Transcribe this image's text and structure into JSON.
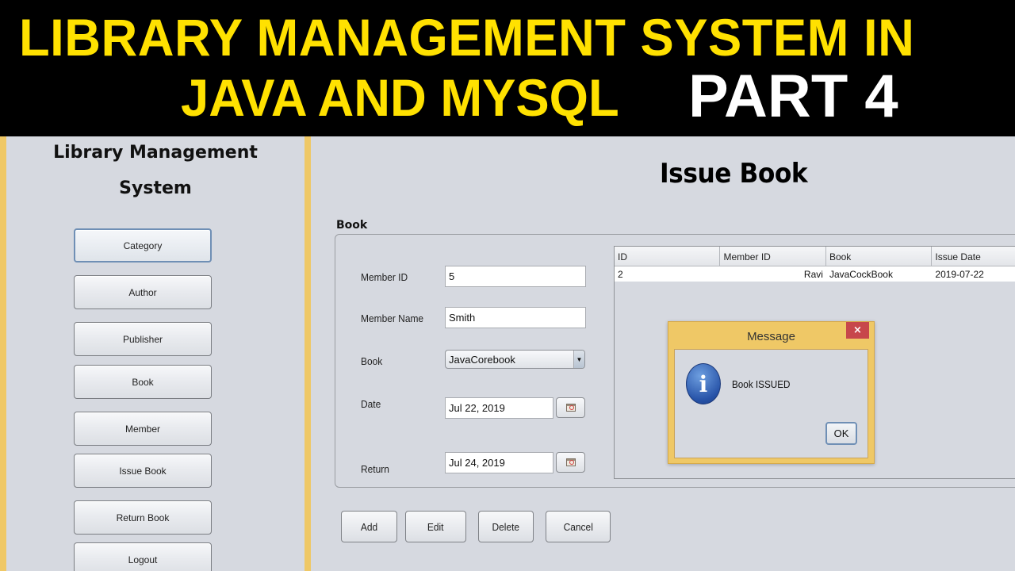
{
  "banner": {
    "line1": "LIBRARY MANAGEMENT SYSTEM IN",
    "line2": "JAVA AND MYSQL",
    "part": "PART 4",
    "title_color": "#ffe100",
    "part_color": "#ffffff"
  },
  "sidebar": {
    "title_line1": "Library Management",
    "title_line2": "System",
    "accent_color": "#efc866",
    "items": [
      {
        "label": "Category"
      },
      {
        "label": "Author"
      },
      {
        "label": "Publisher"
      },
      {
        "label": "Book"
      },
      {
        "label": "Member"
      },
      {
        "label": "Issue Book"
      },
      {
        "label": "Return Book"
      },
      {
        "label": "Logout"
      }
    ]
  },
  "main": {
    "title": "Issue Book",
    "group_label": "Book",
    "form": {
      "member_id_label": "Member ID",
      "member_id_value": "5",
      "member_name_label": "Member Name",
      "member_name_value": "Smith",
      "book_label": "Book",
      "book_selected": "JavaCorebook",
      "date_label": "Date",
      "date_value": "Jul 22, 2019",
      "return_label": "Return",
      "return_value": "Jul 24, 2019"
    },
    "table": {
      "columns": [
        "ID",
        "Member ID",
        "Book",
        "Issue Date"
      ],
      "rows": [
        [
          "2",
          "Ravi",
          "JavaCockBook",
          "2019-07-22"
        ]
      ]
    },
    "actions": {
      "add": "Add",
      "edit": "Edit",
      "delete": "Delete",
      "cancel": "Cancel"
    }
  },
  "dialog": {
    "title": "Message",
    "close_glyph": "×",
    "icon_glyph": "i",
    "message": "Book ISSUED",
    "ok_label": "OK"
  }
}
